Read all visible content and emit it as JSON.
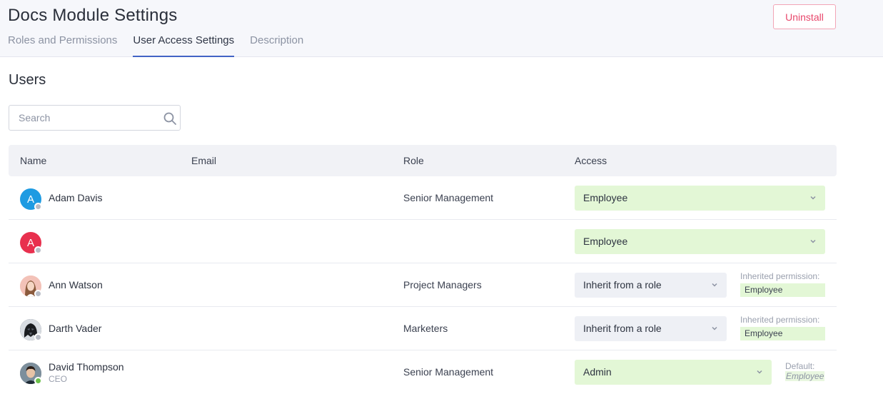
{
  "header": {
    "title": "Docs Module Settings",
    "uninstall_label": "Uninstall",
    "tabs": [
      {
        "label": "Roles and Permissions",
        "active": false
      },
      {
        "label": "User Access Settings",
        "active": true
      },
      {
        "label": "Description",
        "active": false
      }
    ]
  },
  "users": {
    "title": "Users",
    "search_placeholder": "Search",
    "columns": [
      "Name",
      "Email",
      "Role",
      "Access"
    ],
    "rows": [
      {
        "initial": "A",
        "avatar_color": "#1e9be2",
        "name": "Adam Davis",
        "subtitle": "",
        "email": "",
        "role": "Senior Management",
        "access": "Employee",
        "status": "offline"
      },
      {
        "initial": "A",
        "avatar_color": "#e8304e",
        "name": "",
        "subtitle": "",
        "email": "",
        "role": "",
        "access": "Employee",
        "status": "offline"
      },
      {
        "initial": "",
        "avatar_color": "#f3c2b8",
        "name": "Ann Watson",
        "subtitle": "",
        "email": "",
        "role": "Project Managers",
        "access": "Inherit from a role",
        "inherited_label": "Inherited permission:",
        "inherited_value": "Employee",
        "status": "offline"
      },
      {
        "initial": "",
        "avatar_color": "#2b2f36",
        "name": "Darth Vader",
        "subtitle": "",
        "email": "",
        "role": "Marketers",
        "access": "Inherit from a role",
        "inherited_label": "Inherited permission:",
        "inherited_value": "Employee",
        "status": "offline"
      },
      {
        "initial": "",
        "avatar_color": "#5a6b78",
        "name": "David Thompson",
        "subtitle": "CEO",
        "email": "",
        "role": "Senior Management",
        "access": "Admin",
        "default_label": "Default:",
        "default_value": "Employee",
        "status": "online"
      }
    ]
  },
  "colors": {
    "accent": "#4263c5",
    "danger": "#e8476b",
    "access_green": "#e3f7d6",
    "inherit_grey": "#eef0f5"
  }
}
